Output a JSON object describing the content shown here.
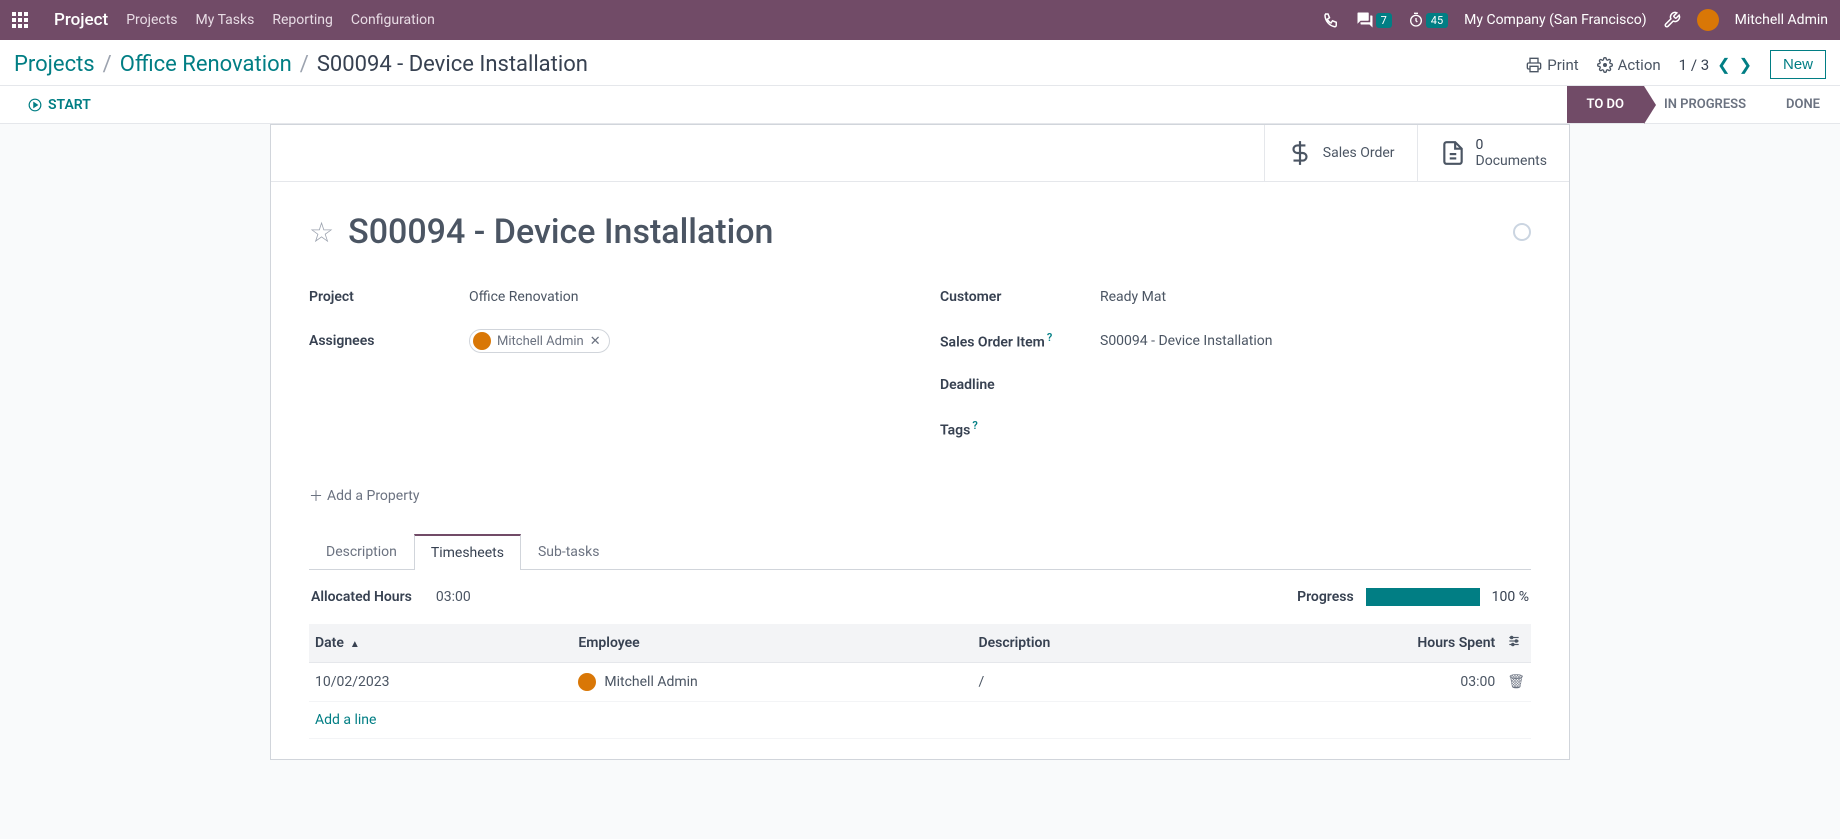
{
  "topbar": {
    "app_name": "Project",
    "nav": [
      "Projects",
      "My Tasks",
      "Reporting",
      "Configuration"
    ],
    "msg_count": "7",
    "timer_count": "45",
    "company": "My Company (San Francisco)",
    "user": "Mitchell Admin"
  },
  "breadcrumb": {
    "root": "Projects",
    "project": "Office Renovation",
    "task": "S00094 - Device Installation"
  },
  "header": {
    "print": "Print",
    "action": "Action",
    "pager": "1 / 3",
    "new": "New"
  },
  "statusbar": {
    "start": "START",
    "stages": [
      "TO DO",
      "IN PROGRESS",
      "DONE"
    ],
    "active_index": 0
  },
  "smart_buttons": {
    "sales_order": "Sales Order",
    "documents_count": "0",
    "documents": "Documents"
  },
  "task": {
    "title": "S00094 - Device Installation",
    "fields_left": {
      "project_label": "Project",
      "project_value": "Office Renovation",
      "assignees_label": "Assignees",
      "assignee_chip": "Mitchell Admin"
    },
    "fields_right": {
      "customer_label": "Customer",
      "customer_value": "Ready Mat",
      "soitem_label": "Sales Order Item",
      "soitem_value": "S00094 - Device Installation",
      "deadline_label": "Deadline",
      "deadline_value": "",
      "tags_label": "Tags",
      "tags_value": ""
    },
    "add_property": "Add a Property"
  },
  "tabs": {
    "description": "Description",
    "timesheets": "Timesheets",
    "subtasks": "Sub-tasks"
  },
  "timesheet": {
    "allocated_label": "Allocated Hours",
    "allocated_value": "03:00",
    "progress_label": "Progress",
    "progress_value": "100 %",
    "columns": {
      "date": "Date",
      "employee": "Employee",
      "description": "Description",
      "hours": "Hours Spent"
    },
    "rows": [
      {
        "date": "10/02/2023",
        "employee": "Mitchell Admin",
        "description": "/",
        "hours": "03:00"
      }
    ],
    "add_line": "Add a line"
  }
}
